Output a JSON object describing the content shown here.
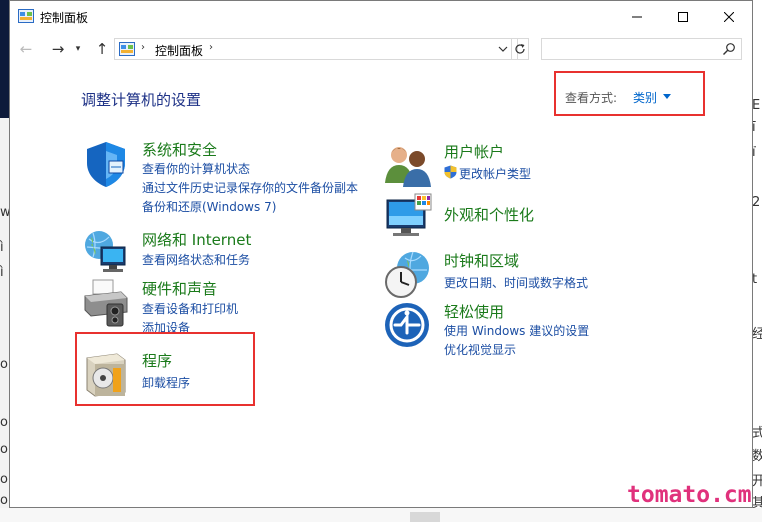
{
  "window": {
    "title": "控制面板"
  },
  "address": {
    "path": "控制面板",
    "search_placeholder": ""
  },
  "heading": "调整计算机的设置",
  "view_by": {
    "label": "查看方式:",
    "value": "类别"
  },
  "categories": [
    {
      "title": "系统和安全",
      "links": [
        "查看你的计算机状态",
        "通过文件历史记录保存你的文件备份副本",
        "备份和还原(Windows 7)"
      ]
    },
    {
      "title": "网络和 Internet",
      "links": [
        "查看网络状态和任务"
      ]
    },
    {
      "title": "硬件和声音",
      "links": [
        "查看设备和打印机",
        "添加设备"
      ]
    },
    {
      "title": "程序",
      "links": [
        "卸载程序"
      ]
    },
    {
      "title": "用户帐户",
      "links": [
        "更改帐户类型"
      ]
    },
    {
      "title": "外观和个性化",
      "links": []
    },
    {
      "title": "时钟和区域",
      "links": [
        "更改日期、时间或数字格式"
      ]
    },
    {
      "title": "轻松使用",
      "links": [
        "使用 Windows 建议的设置",
        "优化视觉显示"
      ]
    }
  ],
  "watermark": "tomato.cm",
  "background_text": [
    "E",
    "ī",
    "ï",
    "2",
    "ws",
    "ì",
    "ì",
    "o",
    "o",
    "o",
    "o",
    "o",
    "t",
    "经",
    "式",
    "数",
    "开",
    "其"
  ],
  "colors": {
    "accent": "#0066cc",
    "category_title": "#1a7a1a",
    "link": "#1c4ea3",
    "heading": "#1e3287",
    "highlight": "#e8312f",
    "watermark": "#e0317c"
  }
}
